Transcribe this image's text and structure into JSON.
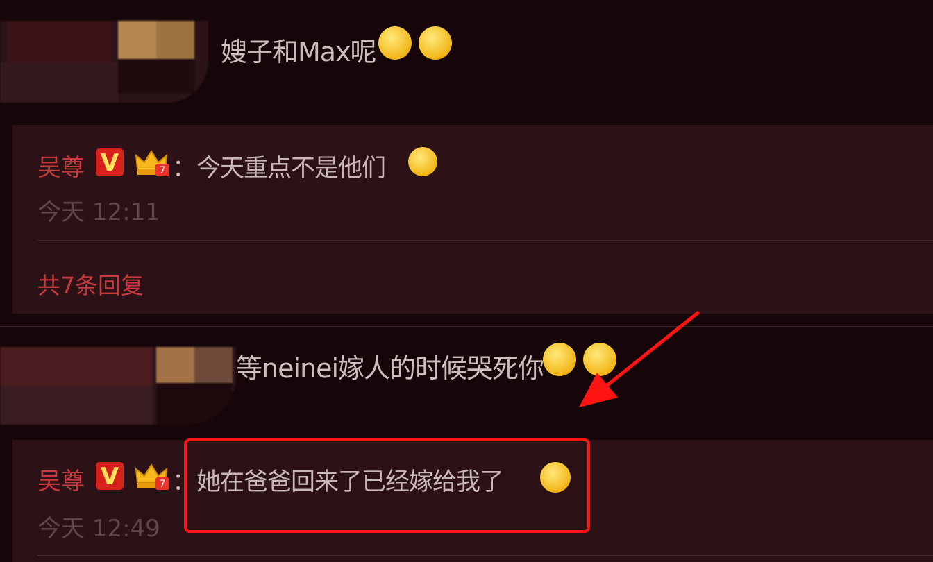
{
  "comments": [
    {
      "text": "嫂子和Max呢"
    },
    {
      "text": "等neinei嫁人的时候哭死你"
    }
  ],
  "replies": [
    {
      "user": "吴尊",
      "badge": "V",
      "separator": "：",
      "text": "今天重点不是他们",
      "time": "今天 12:11",
      "more": "共7条回复"
    },
    {
      "user": "吴尊",
      "badge": "V",
      "separator": "：",
      "text": "她在爸爸回来了已经嫁给我了",
      "time": "今天 12:49"
    }
  ],
  "colors": {
    "background": "#160609",
    "reply_bg": "#2c1216",
    "username": "#c53a3f",
    "highlight": "#ff1414",
    "arrow": "#ff1414"
  },
  "icons": [
    "v-badge-icon",
    "crown-level-icon",
    "emoji-icon",
    "red-arrow-annotation"
  ]
}
